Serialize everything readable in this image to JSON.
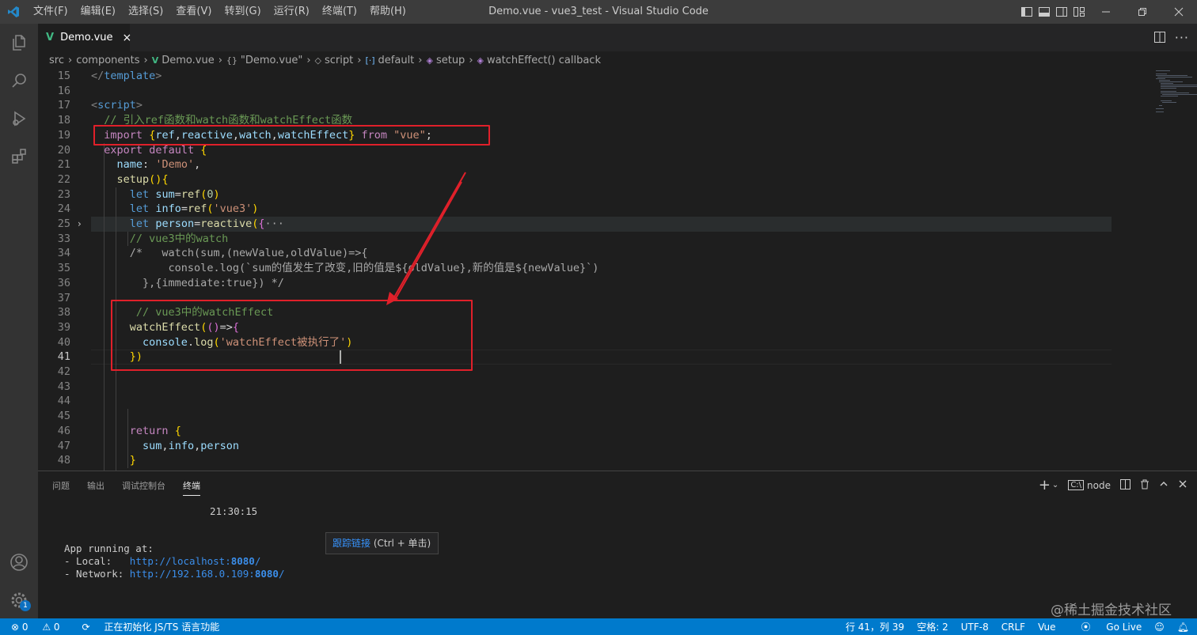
{
  "window": {
    "title": "Demo.vue - vue3_test - Visual Studio Code"
  },
  "menu": [
    "文件(F)",
    "编辑(E)",
    "选择(S)",
    "查看(V)",
    "转到(G)",
    "运行(R)",
    "终端(T)",
    "帮助(H)"
  ],
  "tab": {
    "label": "Demo.vue",
    "close": "×"
  },
  "breadcrumb": [
    "src",
    "components",
    "Demo.vue",
    "\"Demo.vue\"",
    "script",
    "default",
    "setup",
    "watchEffect() callback"
  ],
  "editor": {
    "lines": [
      {
        "n": "15",
        "t": "</template>"
      },
      {
        "n": "16",
        "t": ""
      },
      {
        "n": "17",
        "t": "<script>"
      },
      {
        "n": "18",
        "t": "  // 引入ref函数和watch函数和watchEffect函数"
      },
      {
        "n": "19",
        "t": "  import {ref,reactive,watch,watchEffect} from \"vue\";"
      },
      {
        "n": "20",
        "t": "  export default {"
      },
      {
        "n": "21",
        "t": "    name: 'Demo',"
      },
      {
        "n": "22",
        "t": "    setup(){"
      },
      {
        "n": "23",
        "t": "      let sum=ref(0)"
      },
      {
        "n": "24",
        "t": "      let info=ref('vue3')"
      },
      {
        "n": "25",
        "t": "      let person=reactive({···"
      },
      {
        "n": "33",
        "t": "      // vue3中的watch"
      },
      {
        "n": "34",
        "t": "      /*   watch(sum,(newValue,oldValue)=>{"
      },
      {
        "n": "35",
        "t": "            console.log(`sum的值发生了改变,旧的值是${oldValue},新的值是${newValue}`)"
      },
      {
        "n": "36",
        "t": "        },{immediate:true}) */"
      },
      {
        "n": "37",
        "t": ""
      },
      {
        "n": "38",
        "t": "       // vue3中的watchEffect"
      },
      {
        "n": "39",
        "t": "      watchEffect(()=>{"
      },
      {
        "n": "40",
        "t": "        console.log('watchEffect被执行了')"
      },
      {
        "n": "41",
        "t": "      })"
      },
      {
        "n": "42",
        "t": ""
      },
      {
        "n": "43",
        "t": ""
      },
      {
        "n": "44",
        "t": ""
      },
      {
        "n": "45",
        "t": ""
      },
      {
        "n": "46",
        "t": "      return {"
      },
      {
        "n": "47",
        "t": "        sum,info,person"
      },
      {
        "n": "48",
        "t": "      }"
      },
      {
        "n": "49",
        "t": "    }"
      }
    ],
    "fold_marker": "···"
  },
  "panel": {
    "tabs": [
      "问题",
      "输出",
      "调试控制台",
      "终端"
    ],
    "active_tab": "终端",
    "shell": "node",
    "terminal": {
      "time": "21:30:15",
      "running": "App running at:",
      "local_label": "- Local:   ",
      "local_url_pre": "http://localhost:",
      "local_port": "8080",
      "local_url_post": "/",
      "network_label": "- Network: ",
      "network_url_pre": "http://192.168.0.109:",
      "network_port": "8080",
      "network_url_post": "/"
    },
    "tooltip": {
      "link": "跟踪链接",
      "hint": " (Ctrl + 单击)"
    }
  },
  "statusbar": {
    "errors": "0",
    "warnings": "0",
    "progress": "正在初始化 JS/TS 语言功能",
    "position": "行 41，列 39",
    "spaces": "空格: 2",
    "encoding": "UTF-8",
    "eol": "CRLF",
    "language": "Vue",
    "golive": "Go Live"
  },
  "accounts_badge": "1",
  "watermark": "@稀土掘金技术社区",
  "colors": {
    "statusbar": "#007acc",
    "annotation": "#e0202a",
    "activitybar": "#333333",
    "titlebar": "#3c3c3c"
  }
}
